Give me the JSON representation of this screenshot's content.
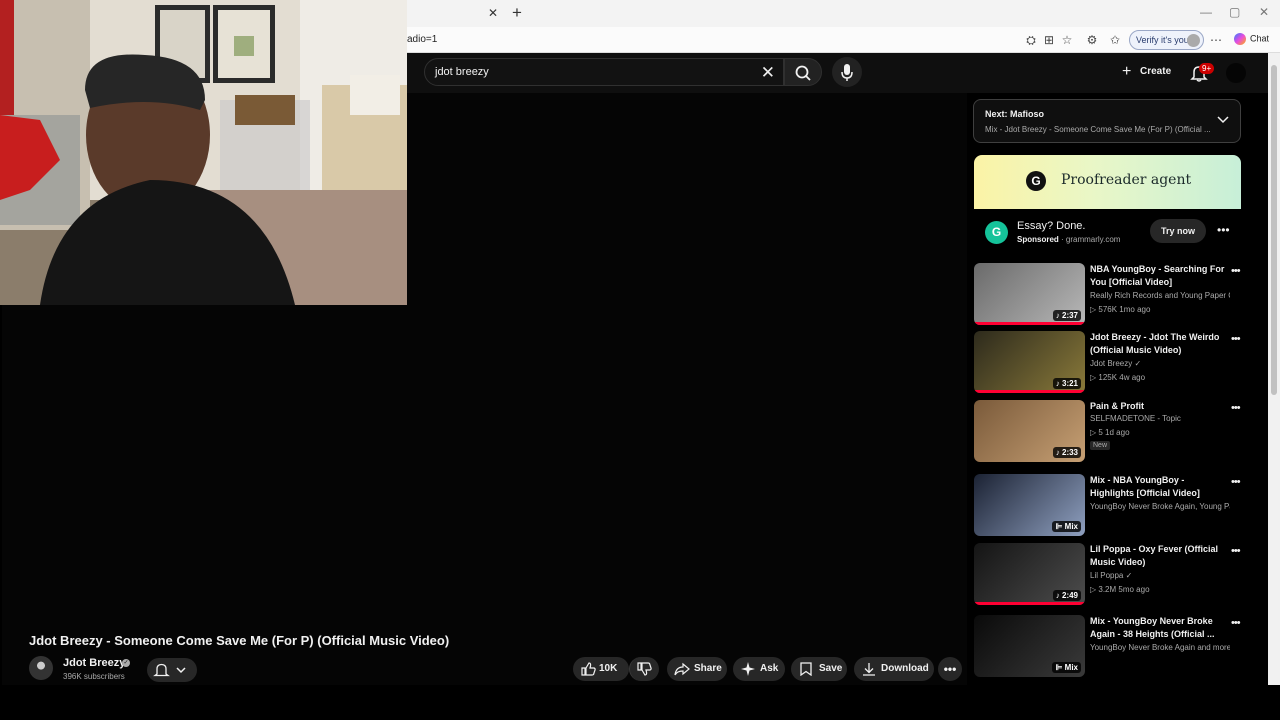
{
  "browser": {
    "url_fragment": "adio=1",
    "verify_label": "Verify it's you",
    "chat_label": "Chat"
  },
  "search": {
    "query": "jdot breezy"
  },
  "header": {
    "create_label": "Create",
    "notif_badge": "9+"
  },
  "video": {
    "title": "Jdot Breezy - Someone Come Save Me (For P) (Official Music Video)",
    "channel": "Jdot Breezy",
    "subscribers": "396K subscribers",
    "likes": "10K",
    "share_label": "Share",
    "ask_label": "Ask",
    "save_label": "Save",
    "download_label": "Download"
  },
  "up_next": {
    "title": "Next: Mafioso",
    "subtitle": "Mix - Jdot Breezy - Someone Come Save Me (For P) (Official ..."
  },
  "ad": {
    "banner_text": "Proofreader agent",
    "title": "Essay? Done.",
    "sponsored": "Sponsored",
    "domain": "· grammarly.com",
    "cta": "Try now"
  },
  "recommendations": [
    {
      "title": "NBA YoungBoy - Searching For You [Official Video]",
      "channel": "Really Rich Records and Young Paper Ch...",
      "meta": "▷ 576K   1mo ago",
      "duration": "♪ 2:37",
      "progress": 1.0,
      "verified": false,
      "badge": "",
      "colors": [
        "#6a6a6a",
        "#b8b8b8"
      ]
    },
    {
      "title": "Jdot Breezy - Jdot The Weirdo (Official Music Video)",
      "channel": "Jdot Breezy",
      "meta": "▷ 125K   4w ago",
      "duration": "♪ 3:21",
      "progress": 1.0,
      "verified": true,
      "badge": "",
      "colors": [
        "#2d2a1c",
        "#8a7a3a"
      ]
    },
    {
      "title": "Pain & Profit",
      "channel": "SELFMADETONE - Topic",
      "meta": "▷ 5   1d ago",
      "duration": "♪ 2:33",
      "progress": 0,
      "verified": false,
      "badge": "New",
      "colors": [
        "#7a5a3a",
        "#c7a074"
      ]
    },
    {
      "title": "Mix - NBA YoungBoy - Highlights [Official Video]",
      "channel": "YoungBoy Never Broke Again, Young Pap...",
      "meta": "",
      "duration": "⊫ Mix",
      "progress": 0,
      "verified": false,
      "badge": "",
      "colors": [
        "#1b2233",
        "#8fa0c0"
      ]
    },
    {
      "title": "Lil Poppa - Oxy Fever (Official Music Video)",
      "channel": "Lil Poppa",
      "meta": "▷ 3.2M   5mo ago",
      "duration": "♪ 2:49",
      "progress": 1.0,
      "verified": true,
      "badge": "",
      "colors": [
        "#141414",
        "#4d4d4d"
      ]
    },
    {
      "title": "Mix - YoungBoy Never Broke Again - 38 Heights (Official ...",
      "channel": "YoungBoy Never Broke Again and more",
      "meta": "",
      "duration": "⊫ Mix",
      "progress": 0,
      "verified": false,
      "badge": "",
      "colors": [
        "#0a0a0a",
        "#3a3a3a"
      ]
    }
  ]
}
